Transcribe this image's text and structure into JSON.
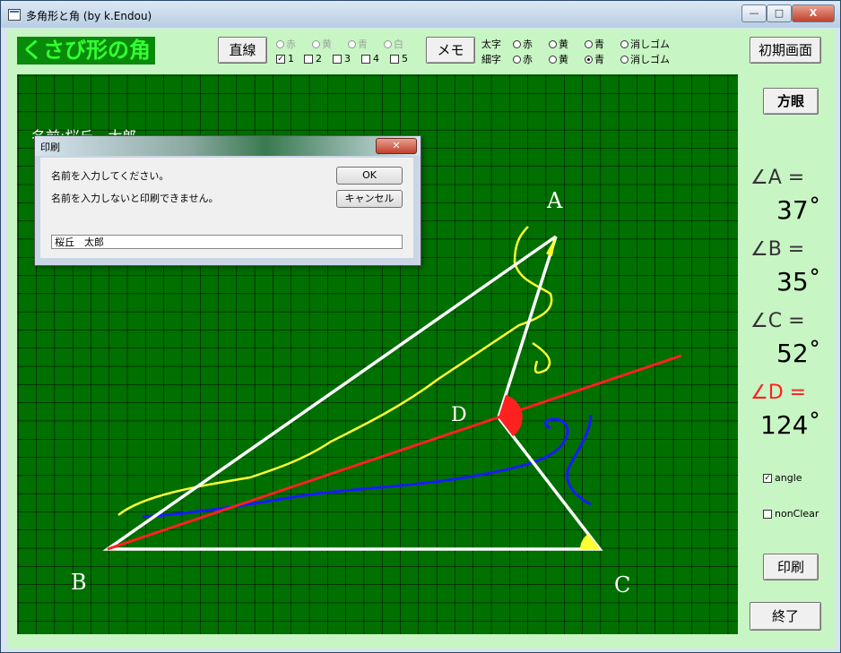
{
  "window": {
    "title": "多角形と角 (by k.Endou)",
    "minimize": "—",
    "maximize": "□",
    "close": "X"
  },
  "app": {
    "title_label": "くさび形の角",
    "btn_line": "直線",
    "btn_memo": "メモ",
    "btn_reset": "初期画面",
    "btn_grid": "方眼",
    "btn_print": "印刷",
    "btn_exit": "終了"
  },
  "line_colors": [
    "赤",
    "黄",
    "青",
    "白"
  ],
  "line_checks": [
    "1",
    "2",
    "3",
    "4",
    "5"
  ],
  "memo": {
    "thick_label": "太字",
    "thin_label": "細字",
    "options": [
      "赤",
      "黄",
      "青",
      "消しゴム"
    ],
    "thin_selected": "青"
  },
  "canvas": {
    "name_text": "名前:桜丘　太郎",
    "points": {
      "A": "A",
      "B": "B",
      "C": "C",
      "D": "D"
    }
  },
  "angles": [
    {
      "label": "∠A =",
      "value": "37˚",
      "color": "#333333"
    },
    {
      "label": "∠B =",
      "value": "35˚",
      "color": "#333333"
    },
    {
      "label": "∠C =",
      "value": "52˚",
      "color": "#333333"
    },
    {
      "label": "∠D =",
      "value": "124˚",
      "color": "#ff2020"
    }
  ],
  "options": {
    "angle_label": "angle",
    "angle_checked": true,
    "nonclear_label": "nonClear",
    "nonclear_checked": false
  },
  "dialog": {
    "title": "印刷",
    "message1": "名前を入力してください。",
    "message2": "名前を入力しないと印刷できません。",
    "ok": "OK",
    "cancel": "キャンセル",
    "input_value": "桜丘　太郎"
  },
  "colors": {
    "board": "#007000",
    "grid": "#000000",
    "triangle": "#ffffff",
    "bisector": "#ff2020",
    "memo_yellow": "#ffff33",
    "memo_blue": "#1a1aff",
    "panel": "#c8f5c4",
    "title_fg": "#33ff33"
  }
}
